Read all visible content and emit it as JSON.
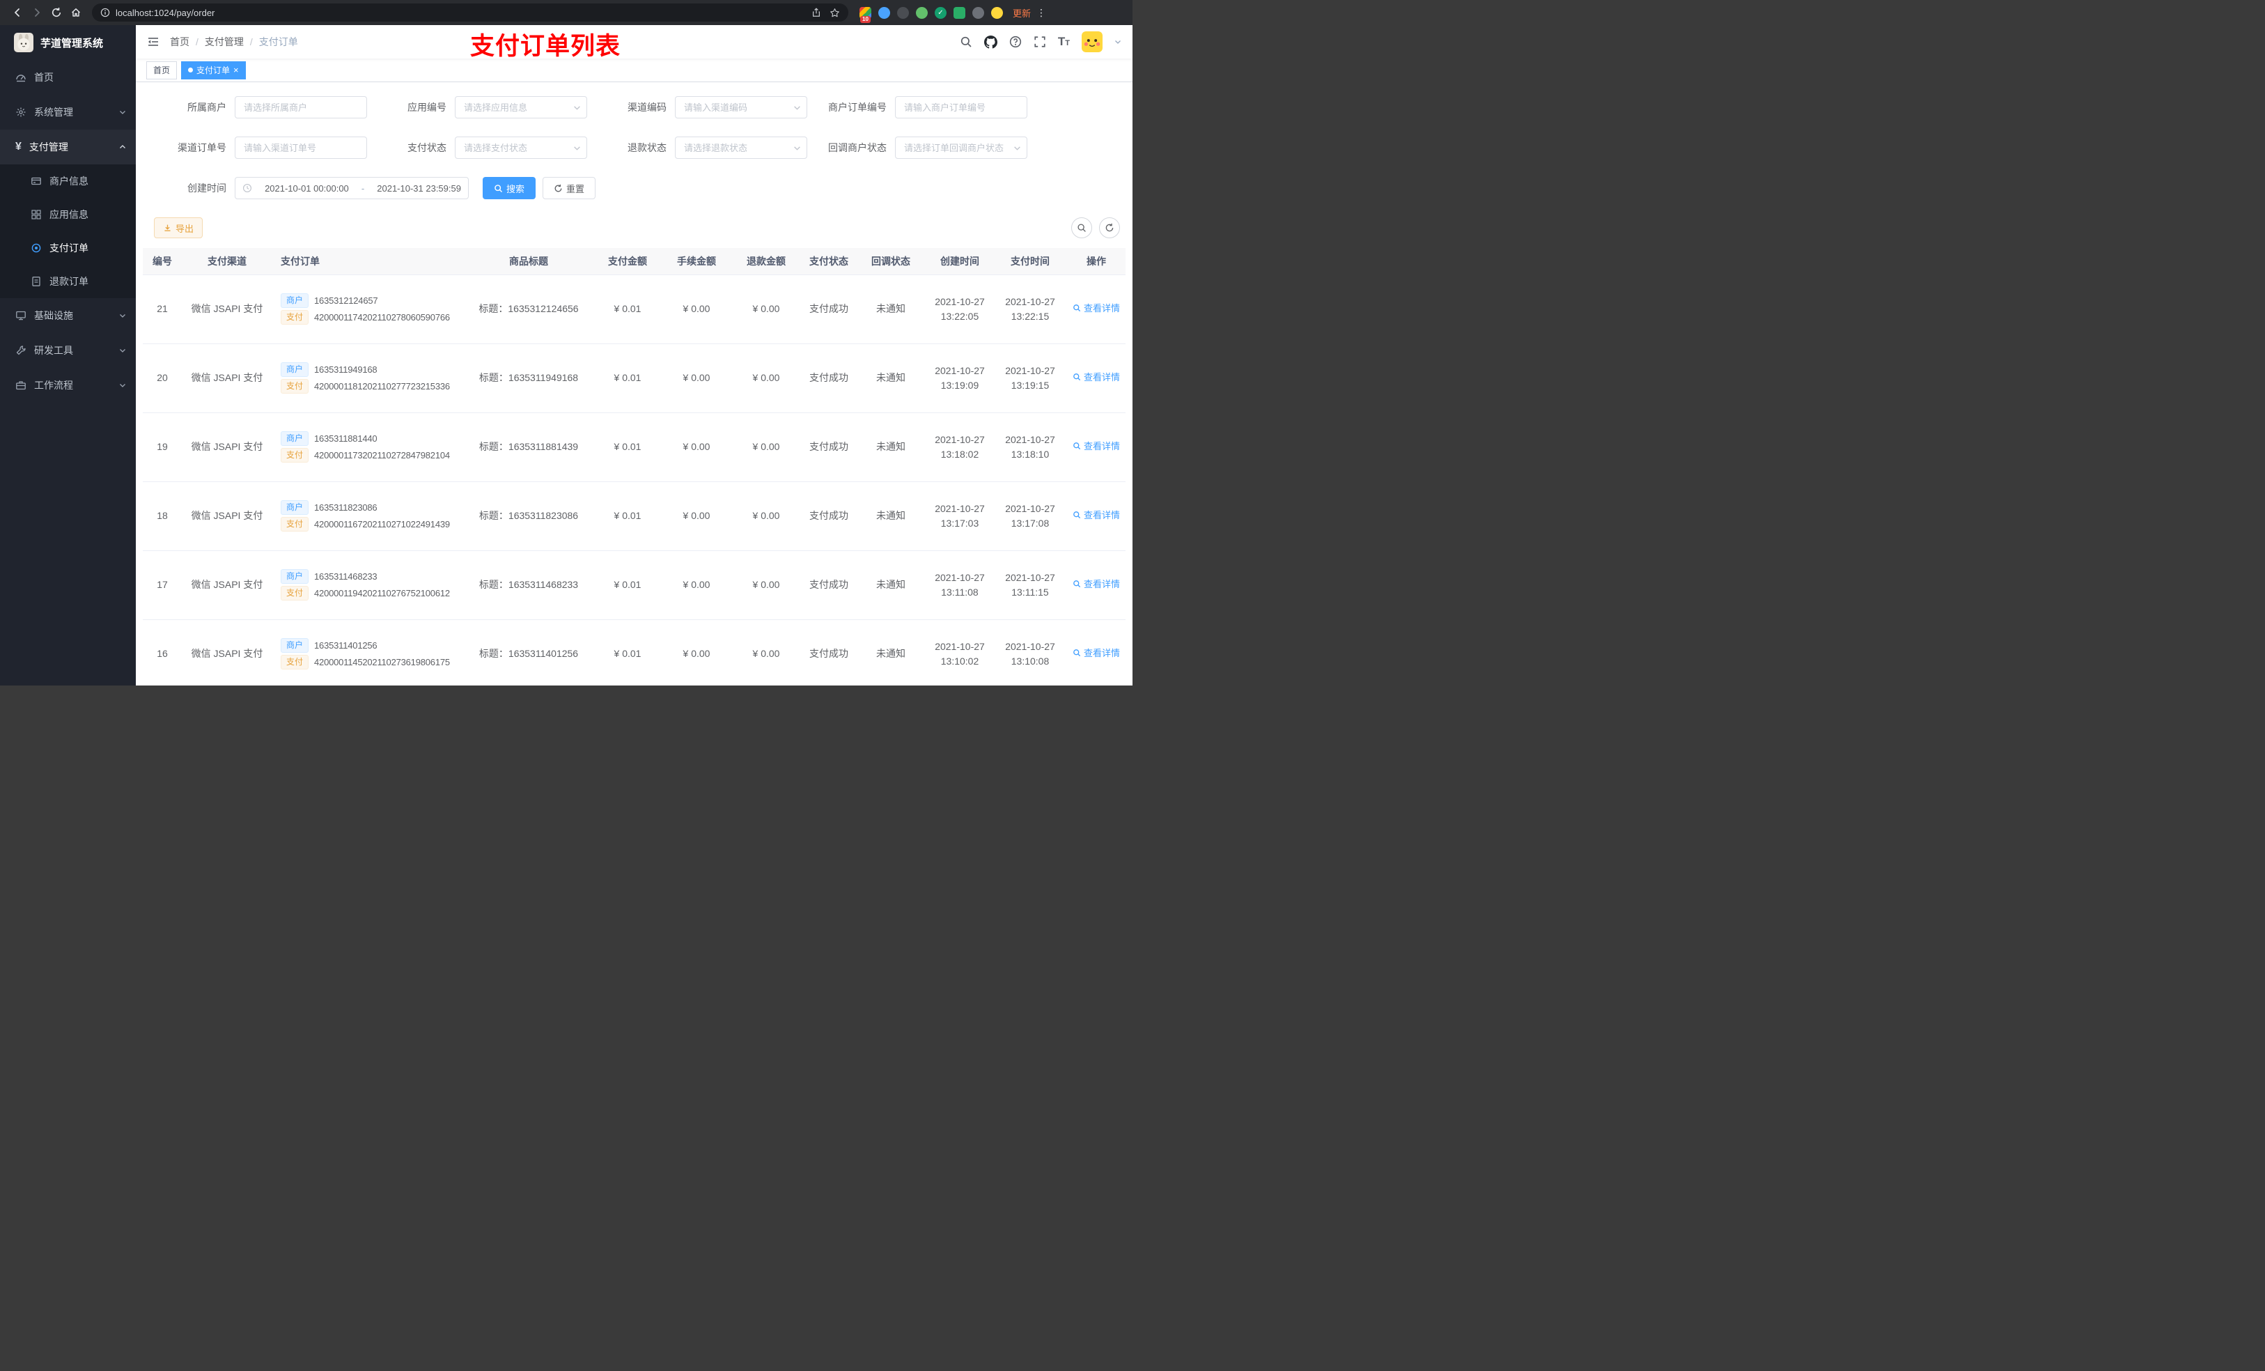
{
  "browser": {
    "url": "localhost:1024/pay/order",
    "update_button": "更新",
    "extension_badge": "10"
  },
  "sidebar": {
    "title": "芋道管理系统",
    "home": "首页",
    "system": "系统管理",
    "payment": "支付管理",
    "merchant_info": "商户信息",
    "app_info": "应用信息",
    "pay_order": "支付订单",
    "refund_order": "退款订单",
    "infra": "基础设施",
    "dev_tools": "研发工具",
    "workflow": "工作流程"
  },
  "header": {
    "breadcrumb": {
      "home": "首页",
      "payment": "支付管理",
      "current": "支付订单"
    },
    "annotation": "支付订单列表"
  },
  "tabs": {
    "home": "首页",
    "current": "支付订单"
  },
  "filters": {
    "merchant": {
      "label": "所属商户",
      "placeholder": "请选择所属商户"
    },
    "app": {
      "label": "应用编号",
      "placeholder": "请选择应用信息"
    },
    "channel_code": {
      "label": "渠道编码",
      "placeholder": "请输入渠道编码"
    },
    "merchant_order_no": {
      "label": "商户订单编号",
      "placeholder": "请输入商户订单编号"
    },
    "channel_order_no": {
      "label": "渠道订单号",
      "placeholder": "请输入渠道订单号"
    },
    "pay_status": {
      "label": "支付状态",
      "placeholder": "请选择支付状态"
    },
    "refund_status": {
      "label": "退款状态",
      "placeholder": "请选择退款状态"
    },
    "notify_status": {
      "label": "回调商户状态",
      "placeholder": "请选择订单回调商户状态"
    },
    "create_time": {
      "label": "创建时间",
      "start": "2021-10-01 00:00:00",
      "separator": "-",
      "end": "2021-10-31 23:59:59"
    },
    "search": "搜索",
    "reset": "重置"
  },
  "toolbar": {
    "export": "导出"
  },
  "table": {
    "columns": {
      "id": "编号",
      "channel": "支付渠道",
      "order": "支付订单",
      "title": "商品标题",
      "amount": "支付金额",
      "fee": "手续金额",
      "refund": "退款金额",
      "status": "支付状态",
      "notify": "回调状态",
      "create_time": "创建时间",
      "pay_time": "支付时间",
      "action": "操作"
    },
    "tag_merchant": "商户",
    "tag_pay": "支付",
    "action_label": "查看详情",
    "rows": [
      {
        "id": "21",
        "channel": "微信 JSAPI 支付",
        "merchant_no": "1635312124657",
        "pay_no": "4200001174202110278060590766",
        "title": "标题：1635312124656",
        "amount": "¥ 0.01",
        "fee": "¥ 0.00",
        "refund": "¥ 0.00",
        "status": "支付成功",
        "notify": "未通知",
        "create_time": "2021-10-27 13:22:05",
        "pay_time": "2021-10-27 13:22:15"
      },
      {
        "id": "20",
        "channel": "微信 JSAPI 支付",
        "merchant_no": "1635311949168",
        "pay_no": "4200001181202110277723215336",
        "title": "标题：1635311949168",
        "amount": "¥ 0.01",
        "fee": "¥ 0.00",
        "refund": "¥ 0.00",
        "status": "支付成功",
        "notify": "未通知",
        "create_time": "2021-10-27 13:19:09",
        "pay_time": "2021-10-27 13:19:15"
      },
      {
        "id": "19",
        "channel": "微信 JSAPI 支付",
        "merchant_no": "1635311881440",
        "pay_no": "4200001173202110272847982104",
        "title": "标题：1635311881439",
        "amount": "¥ 0.01",
        "fee": "¥ 0.00",
        "refund": "¥ 0.00",
        "status": "支付成功",
        "notify": "未通知",
        "create_time": "2021-10-27 13:18:02",
        "pay_time": "2021-10-27 13:18:10"
      },
      {
        "id": "18",
        "channel": "微信 JSAPI 支付",
        "merchant_no": "1635311823086",
        "pay_no": "4200001167202110271022491439",
        "title": "标题：1635311823086",
        "amount": "¥ 0.01",
        "fee": "¥ 0.00",
        "refund": "¥ 0.00",
        "status": "支付成功",
        "notify": "未通知",
        "create_time": "2021-10-27 13:17:03",
        "pay_time": "2021-10-27 13:17:08"
      },
      {
        "id": "17",
        "channel": "微信 JSAPI 支付",
        "merchant_no": "1635311468233",
        "pay_no": "4200001194202110276752100612",
        "title": "标题：1635311468233",
        "amount": "¥ 0.01",
        "fee": "¥ 0.00",
        "refund": "¥ 0.00",
        "status": "支付成功",
        "notify": "未通知",
        "create_time": "2021-10-27 13:11:08",
        "pay_time": "2021-10-27 13:11:15"
      },
      {
        "id": "16",
        "channel": "微信 JSAPI 支付",
        "merchant_no": "1635311401256",
        "pay_no": "4200001145202110273619806175",
        "title": "标题：1635311401256",
        "amount": "¥ 0.01",
        "fee": "¥ 0.00",
        "refund": "¥ 0.00",
        "status": "支付成功",
        "notify": "未通知",
        "create_time": "2021-10-27 13:10:02",
        "pay_time": "2021-10-27 13:10:08"
      }
    ]
  }
}
